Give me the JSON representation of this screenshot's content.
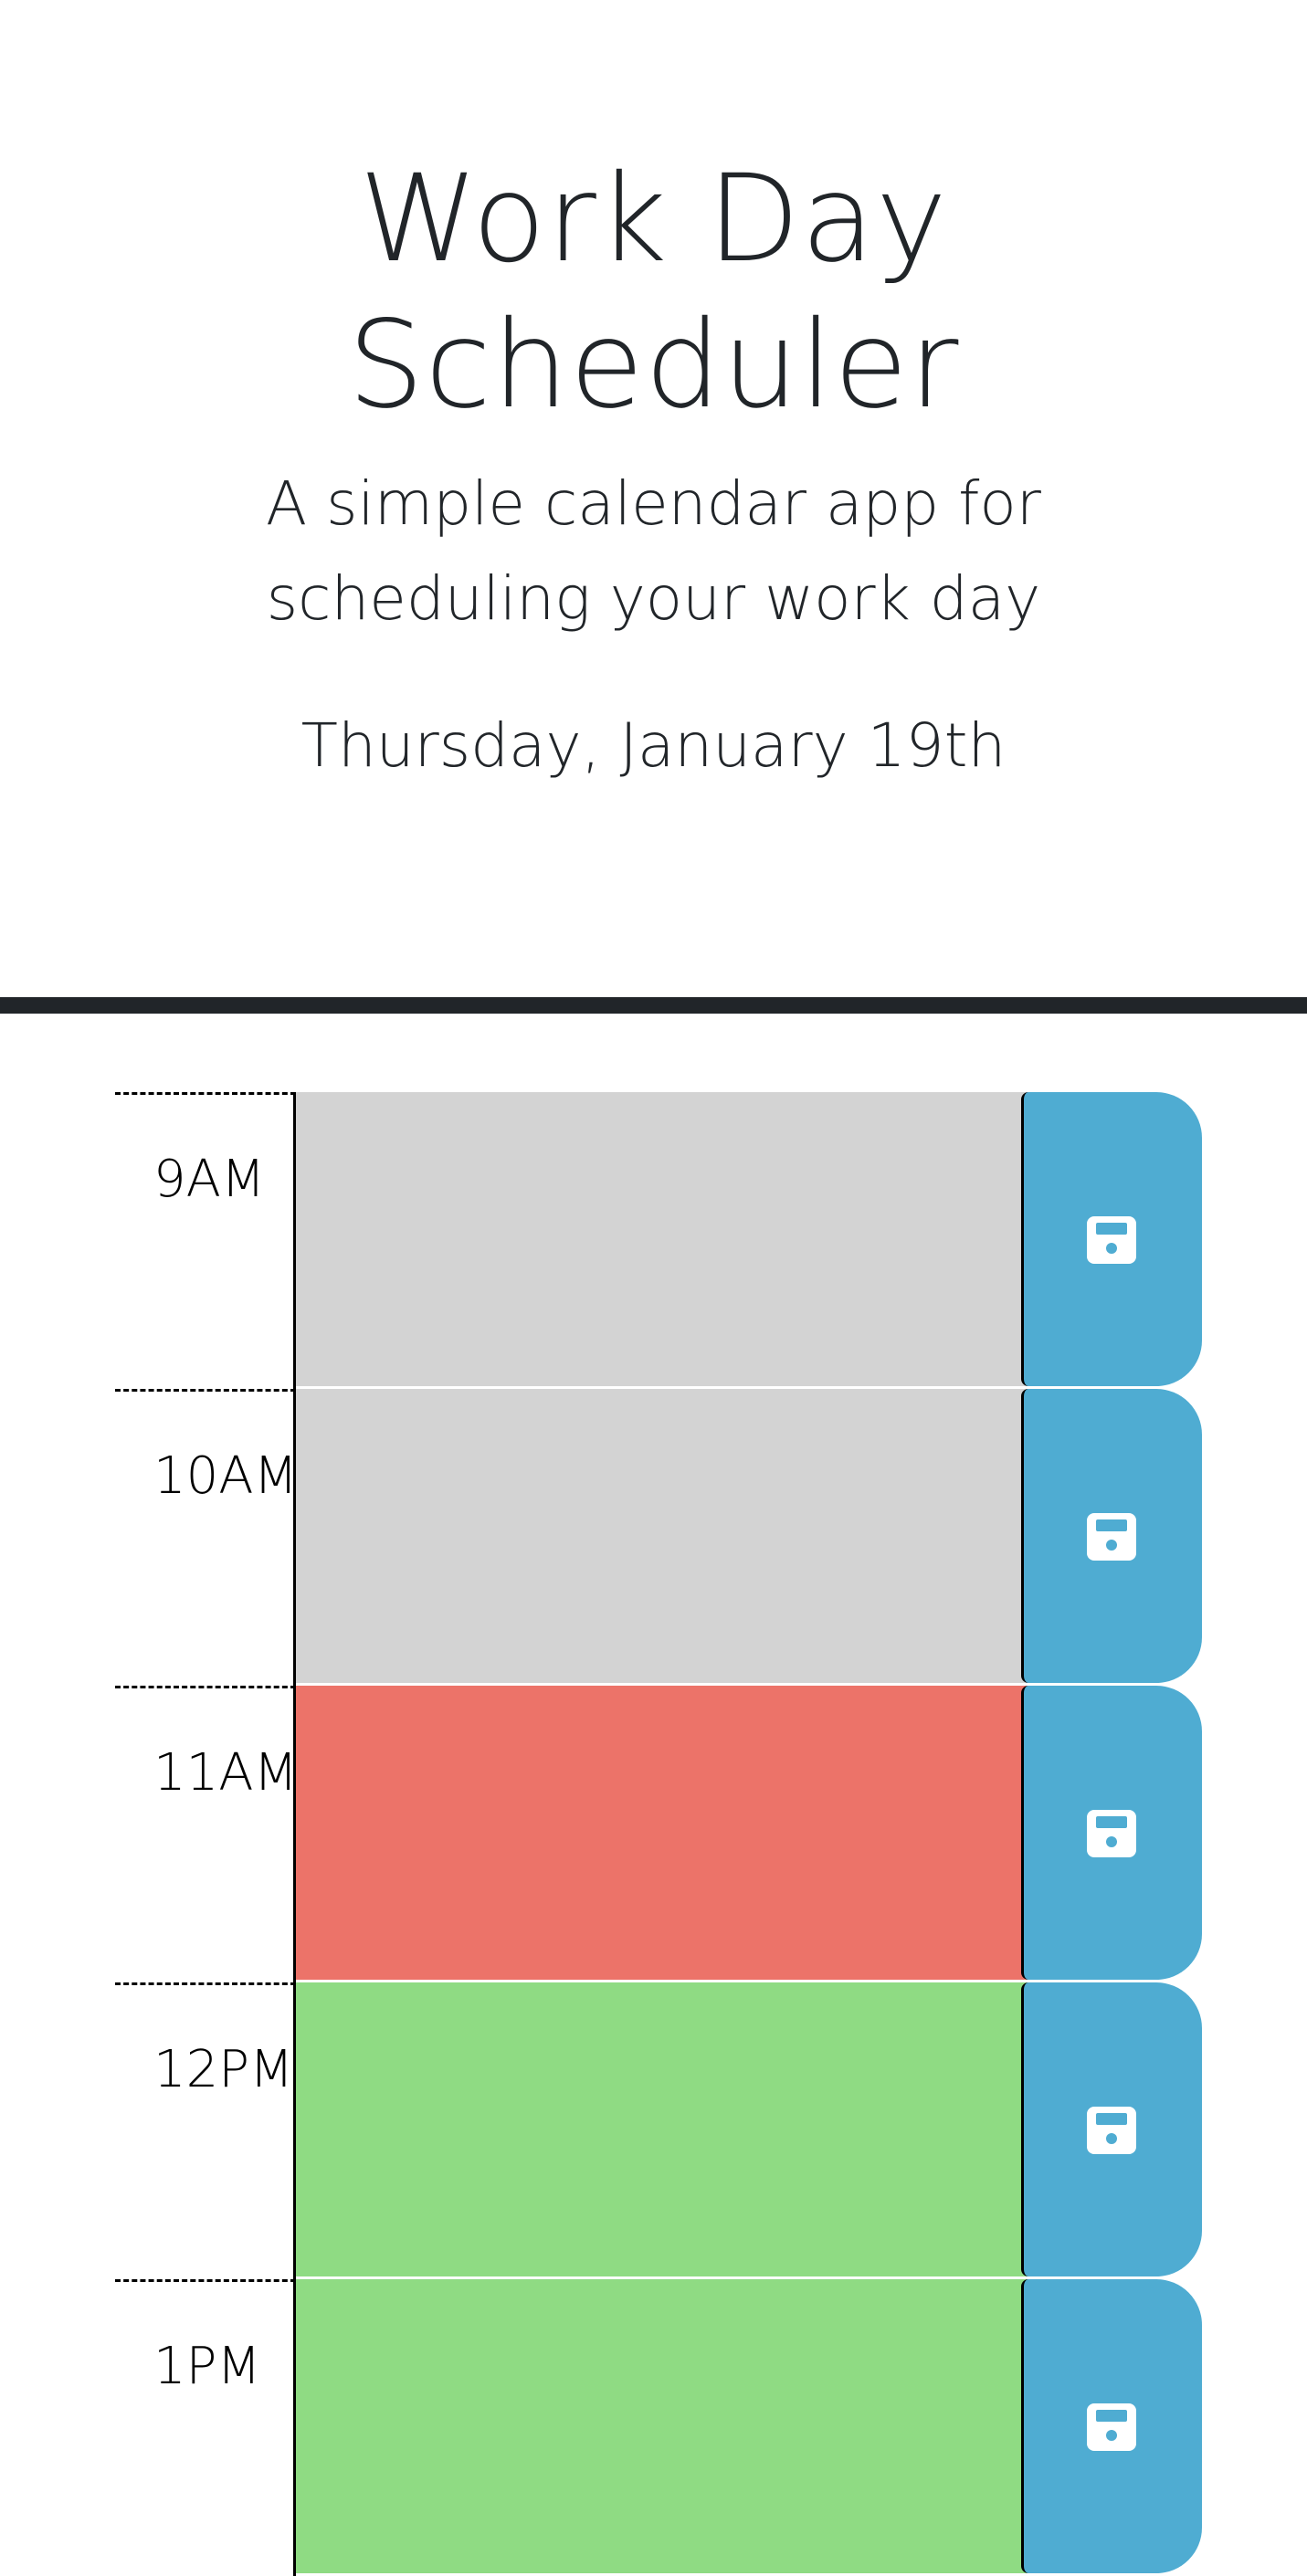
{
  "header": {
    "title_line1": "Work Day",
    "title_line2": "Scheduler",
    "lead_line1": "A simple calendar app for",
    "lead_line2": "scheduling your work day",
    "current_day": "Thursday, January 19th"
  },
  "time_blocks": [
    {
      "hour": "9AM",
      "status": "past",
      "text": ""
    },
    {
      "hour": "10AM",
      "status": "past",
      "text": ""
    },
    {
      "hour": "11AM",
      "status": "present",
      "text": ""
    },
    {
      "hour": "12PM",
      "status": "future",
      "text": ""
    },
    {
      "hour": "1PM",
      "status": "future",
      "text": ""
    }
  ],
  "icons": {
    "save": "floppy-disk-icon"
  },
  "colors": {
    "past": "#d3d3d3",
    "present": "#ec7369",
    "future": "#8fdb83",
    "save_button": "#4facd2",
    "text": "#212529"
  }
}
